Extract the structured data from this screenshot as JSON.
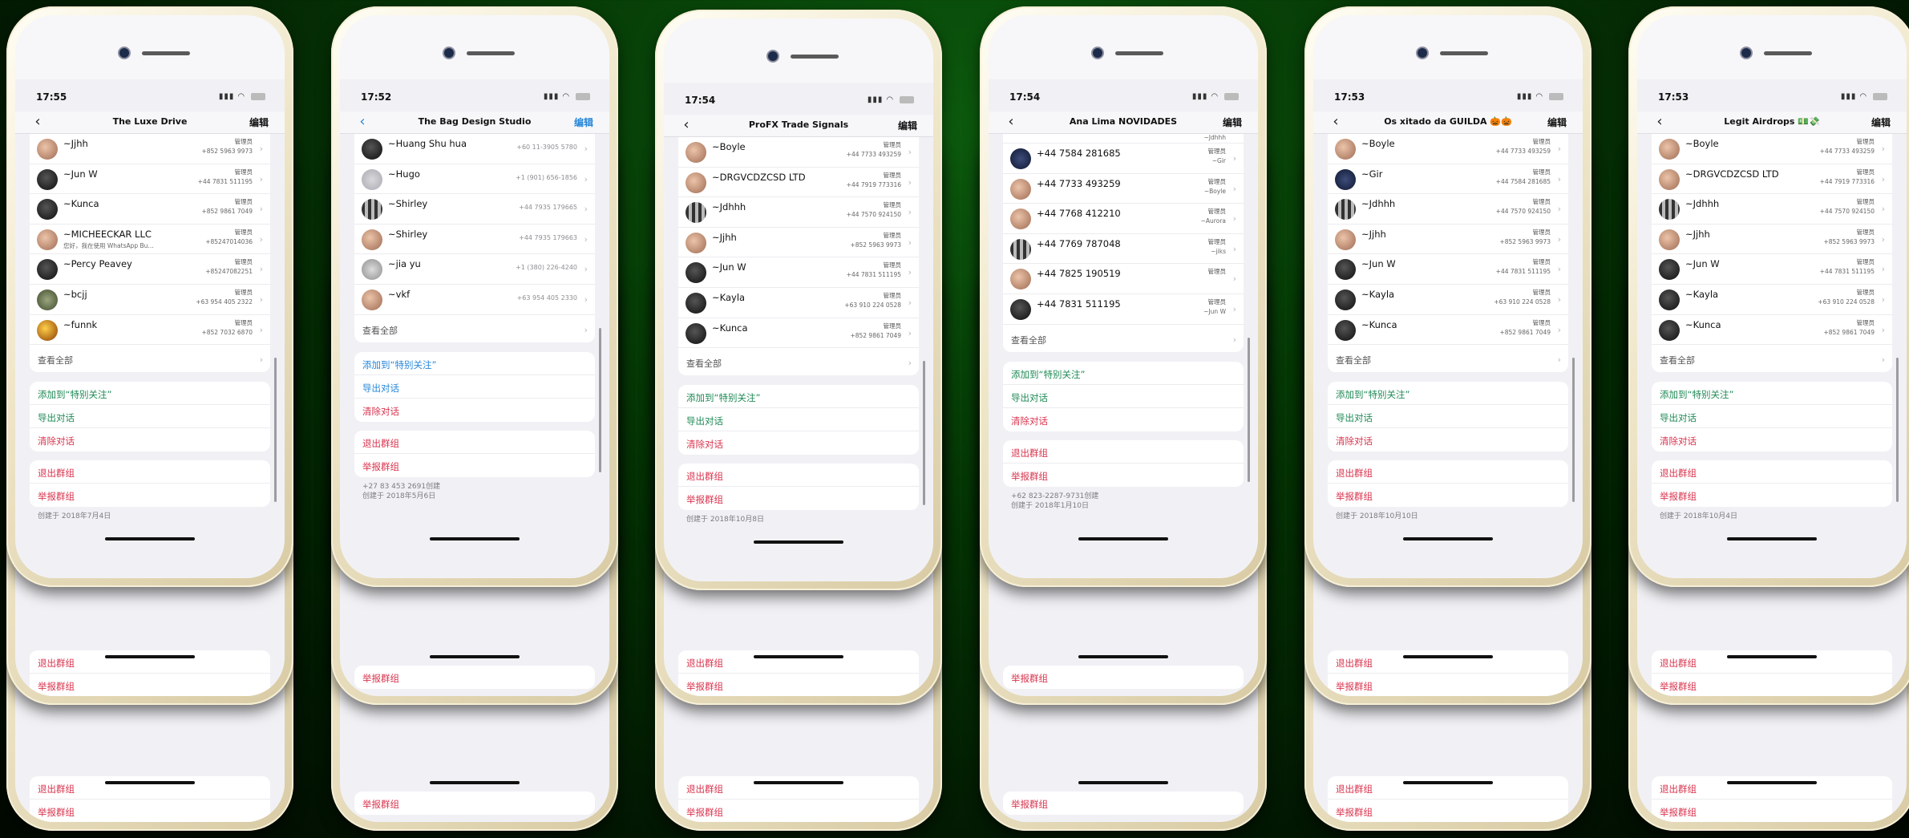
{
  "phones": [
    {
      "time": "17:55",
      "title": "The Luxe Drive",
      "edit": "编辑",
      "nav_style": "dark",
      "members": [
        {
          "name": "~Jjhh",
          "role": "管理员",
          "phone": "+852 5963 9973",
          "avatar": "warm"
        },
        {
          "name": "~Jun W",
          "role": "管理员",
          "phone": "+44 7831 511195",
          "avatar": "dark"
        },
        {
          "name": "~Kunca",
          "role": "管理员",
          "phone": "+852 9861 7049",
          "avatar": "dark"
        },
        {
          "name": "~MICHEECKAR LLC",
          "sub": "您好，我在使用 WhatsApp Bu...",
          "role": "管理员",
          "phone": "+85247014036",
          "avatar": "warm"
        },
        {
          "name": "~Percy Peavey",
          "role": "管理员",
          "phone": "+85247082251",
          "avatar": "dark"
        },
        {
          "name": "~bcjj",
          "role": "管理员",
          "phone": "+63 954 405 2322",
          "avatar": "green"
        },
        {
          "name": "~funnk",
          "role": "管理员",
          "phone": "+852 7032 6870",
          "avatar": "gold"
        }
      ],
      "see_all": "查看全部",
      "actions_a": [
        "添加到“特别关注”",
        "导出对话",
        "清除对话"
      ],
      "actions_b": [
        "退出群组",
        "举报群组"
      ],
      "created": [
        "创建于 2018年7月4日"
      ],
      "back_label_1": "退出群组",
      "back_label_2": "举报群组"
    },
    {
      "time": "17:52",
      "title": "The Bag Design Studio",
      "edit": "编辑",
      "nav_style": "blue",
      "members": [
        {
          "name": "~Huang Shu hua",
          "phone_center": "+60 11-3905 5780",
          "avatar": "dark"
        },
        {
          "name": "~Hugo",
          "phone_center": "+1 (901) 656-1856",
          "avatar": "gray"
        },
        {
          "name": "~Shirley",
          "phone_center": "+44 7935 179665",
          "avatar": "bw"
        },
        {
          "name": "~Shirley",
          "phone_center": "+44 7935 179663",
          "avatar": "warm"
        },
        {
          "name": "~jia yu",
          "phone_center": "+1 (380) 226-4240",
          "avatar": "ltgray"
        },
        {
          "name": "~vkf",
          "phone_center": "+63 954 405 2330",
          "avatar": "warm"
        }
      ],
      "see_all": "查看全部",
      "actions_a": [
        "添加到“特别关注”",
        "导出对话",
        "清除对话"
      ],
      "actions_b": [
        "退出群组",
        "举报群组"
      ],
      "created": [
        "+27 83 453 2691创建",
        "创建于 2018年5月6日"
      ],
      "back_label_1": "举报群组",
      "back_label_2": ""
    },
    {
      "time": "17:54",
      "title": "ProFX Trade Signals",
      "edit": "编辑",
      "nav_style": "dark",
      "members": [
        {
          "name": "~Boyle",
          "role": "管理员",
          "phone": "+44 7733 493259",
          "avatar": "warm"
        },
        {
          "name": "~DRGVCDZCSD LTD",
          "role": "管理员",
          "phone": "+44 7919 773316",
          "avatar": "warm"
        },
        {
          "name": "~Jdhhh",
          "role": "管理员",
          "phone": "+44 7570 924150",
          "avatar": "bw"
        },
        {
          "name": "~Jjhh",
          "role": "管理员",
          "phone": "+852 5963 9973",
          "avatar": "warm"
        },
        {
          "name": "~Jun W",
          "role": "管理员",
          "phone": "+44 7831 511195",
          "avatar": "dark"
        },
        {
          "name": "~Kayla",
          "role": "管理员",
          "phone": "+63 910 224 0528",
          "avatar": "dark"
        },
        {
          "name": "~Kunca",
          "role": "管理员",
          "phone": "+852 9861 7049",
          "avatar": "dark"
        }
      ],
      "see_all": "查看全部",
      "actions_a": [
        "添加到“特别关注”",
        "导出对话",
        "清除对话"
      ],
      "actions_b": [
        "退出群组",
        "举报群组"
      ],
      "created": [
        "创建于 2018年10月8日"
      ],
      "back_label_1": "退出群组",
      "back_label_2": "举报群组"
    },
    {
      "time": "17:54",
      "title": "Ana Lima NOVIDADES",
      "edit": "编辑",
      "nav_style": "dark",
      "members": [
        {
          "name": "+44 7584 281685",
          "role": "管理员",
          "phone": "~Gir",
          "avatar": "blue"
        },
        {
          "name": "+44 7733 493259",
          "role": "管理员",
          "phone": "~Boyle",
          "avatar": "warm"
        },
        {
          "name": "+44 7768 412210",
          "role": "管理员",
          "phone": "~Aurora",
          "avatar": "warm"
        },
        {
          "name": "+44 7769 787048",
          "role": "管理员",
          "phone": "~jiks",
          "avatar": "bw"
        },
        {
          "name": "+44 7825 190519",
          "role": "管理员",
          "phone": "",
          "avatar": "warm"
        },
        {
          "name": "+44 7831 511195",
          "role": "管理员",
          "phone": "~Jun W",
          "avatar": "dark"
        }
      ],
      "top_partial": "~Jdhhh",
      "see_all": "查看全部",
      "actions_a": [
        "添加到“特别关注”",
        "导出对话",
        "清除对话"
      ],
      "actions_b": [
        "退出群组",
        "举报群组"
      ],
      "created": [
        "+62 823-2287-9731创建",
        "创建于 2018年1月10日"
      ],
      "back_label_1": "举报群组",
      "back_label_2": ""
    },
    {
      "time": "17:53",
      "title": "Os xitado da GUILDA 🎃🎃",
      "edit": "编辑",
      "nav_style": "dark",
      "members": [
        {
          "name": "~Boyle",
          "role": "管理员",
          "phone": "+44 7733 493259",
          "avatar": "warm"
        },
        {
          "name": "~Gir",
          "role": "管理员",
          "phone": "+44 7584 281685",
          "avatar": "blue"
        },
        {
          "name": "~Jdhhh",
          "role": "管理员",
          "phone": "+44 7570 924150",
          "avatar": "bw"
        },
        {
          "name": "~Jjhh",
          "role": "管理员",
          "phone": "+852 5963 9973",
          "avatar": "warm"
        },
        {
          "name": "~Jun W",
          "role": "管理员",
          "phone": "+44 7831 511195",
          "avatar": "dark"
        },
        {
          "name": "~Kayla",
          "role": "管理员",
          "phone": "+63 910 224 0528",
          "avatar": "dark"
        },
        {
          "name": "~Kunca",
          "role": "管理员",
          "phone": "+852 9861 7049",
          "avatar": "dark"
        }
      ],
      "see_all": "查看全部",
      "actions_a": [
        "添加到“特别关注”",
        "导出对话",
        "清除对话"
      ],
      "actions_b": [
        "退出群组",
        "举报群组"
      ],
      "created": [
        "创建于 2018年10月10日"
      ],
      "back_label_1": "退出群组",
      "back_label_2": "举报群组"
    },
    {
      "time": "17:53",
      "title": "Legit Airdrops 💵💸",
      "edit": "编辑",
      "nav_style": "dark",
      "members": [
        {
          "name": "~Boyle",
          "role": "管理员",
          "phone": "+44 7733 493259",
          "avatar": "warm"
        },
        {
          "name": "~DRGVCDZCSD LTD",
          "role": "管理员",
          "phone": "+44 7919 773316",
          "avatar": "warm"
        },
        {
          "name": "~Jdhhh",
          "role": "管理员",
          "phone": "+44 7570 924150",
          "avatar": "bw"
        },
        {
          "name": "~Jjhh",
          "role": "管理员",
          "phone": "+852 5963 9973",
          "avatar": "warm"
        },
        {
          "name": "~Jun W",
          "role": "管理员",
          "phone": "+44 7831 511195",
          "avatar": "dark"
        },
        {
          "name": "~Kayla",
          "role": "管理员",
          "phone": "+63 910 224 0528",
          "avatar": "dark"
        },
        {
          "name": "~Kunca",
          "role": "管理员",
          "phone": "+852 9861 7049",
          "avatar": "dark"
        }
      ],
      "see_all": "查看全部",
      "actions_a": [
        "添加到“特别关注”",
        "导出对话",
        "清除对话"
      ],
      "actions_b": [
        "退出群组",
        "举报群组"
      ],
      "created": [
        "创建于 2018年10月4日"
      ],
      "back_label_1": "退出群组",
      "back_label_2": "举报群组"
    }
  ]
}
